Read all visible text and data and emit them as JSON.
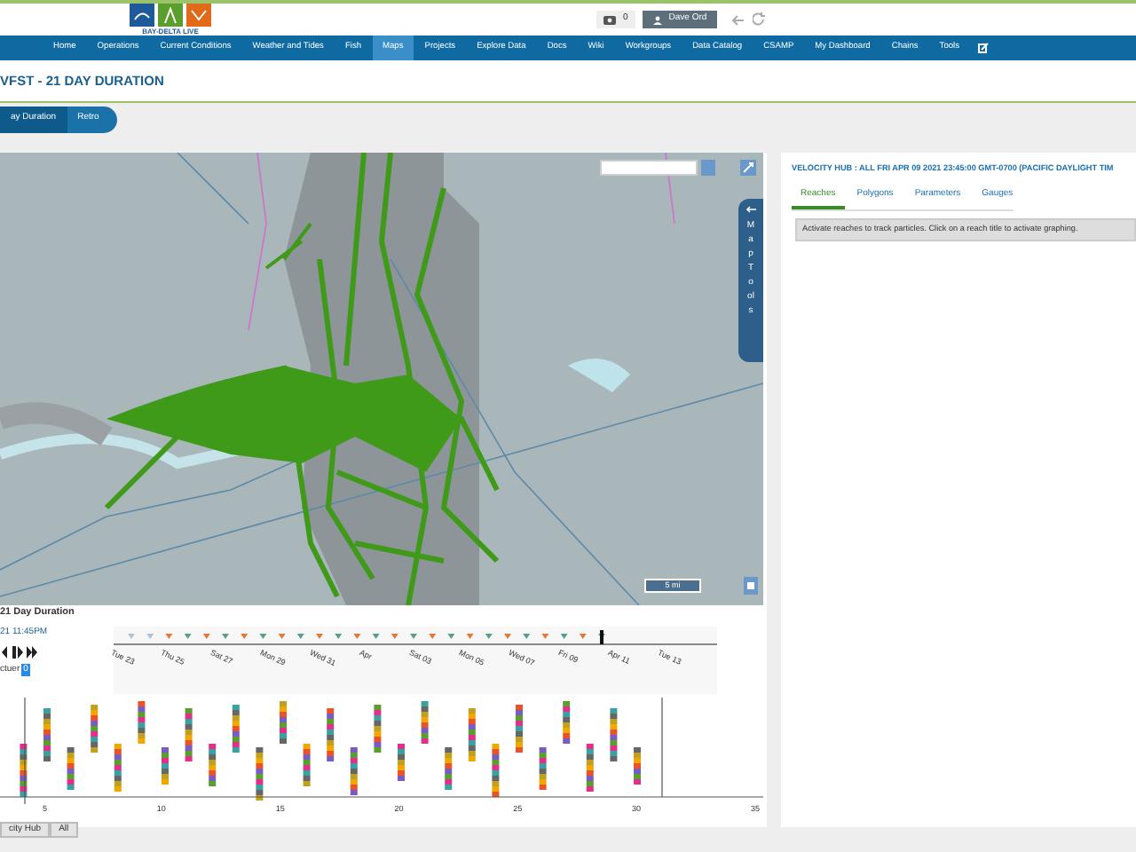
{
  "header": {
    "logo_text": "BAY-DELTA LIVE",
    "notifications": {
      "count": "0"
    },
    "user": {
      "name": "Dave Ord"
    }
  },
  "nav": [
    {
      "label": "Home",
      "selected": false
    },
    {
      "label": "Operations",
      "selected": false
    },
    {
      "label": "Current Conditions",
      "selected": false
    },
    {
      "label": "Weather and Tides",
      "selected": false
    },
    {
      "label": "Fish",
      "selected": false
    },
    {
      "label": "Maps",
      "selected": true
    },
    {
      "label": "Projects",
      "selected": false
    },
    {
      "label": "Explore Data",
      "selected": false
    },
    {
      "label": "Docs",
      "selected": false
    },
    {
      "label": "Wiki",
      "selected": false
    },
    {
      "label": "Workgroups",
      "selected": false
    },
    {
      "label": "Data Catalog",
      "selected": false
    },
    {
      "label": "CSAMP",
      "selected": false
    },
    {
      "label": "My Dashboard",
      "selected": false
    },
    {
      "label": "Chains",
      "selected": false
    },
    {
      "label": "Tools",
      "selected": false
    }
  ],
  "page_title": "VFST - 21 DAY DURATION",
  "tabs": [
    {
      "label": "ay Duration",
      "selected": true
    },
    {
      "label": "Retro",
      "selected": false
    }
  ],
  "map": {
    "scale": "5 mi",
    "tools_label": "Map Tools"
  },
  "timeline": {
    "title": "21 Day Duration",
    "current_time": "21 11:45PM",
    "structure_label": "ctuer",
    "structure_value": "0",
    "dates": [
      "Tue 23",
      "Thu 25",
      "Sat 27",
      "Mon 29",
      "Wed 31",
      "Apr",
      "Sat 03",
      "Mon 05",
      "Wed 07",
      "Fri 09",
      "Apr 11",
      "Tue 13"
    ],
    "x_ticks": [
      "5",
      "10",
      "15",
      "20",
      "25",
      "30",
      "35"
    ]
  },
  "bottom_tabs": [
    {
      "label": "city Hub",
      "selected": false
    },
    {
      "label": "All",
      "selected": false
    }
  ],
  "side_panel": {
    "title": "VELOCITY HUB : ALL FRI APR 09 2021 23:45:00 GMT-0700 (PACIFIC DAYLIGHT TIM",
    "tabs": [
      {
        "label": "Reaches",
        "selected": true
      },
      {
        "label": "Polygons",
        "selected": false
      },
      {
        "label": "Parameters",
        "selected": false
      },
      {
        "label": "Gauges",
        "selected": false
      }
    ],
    "message": "Activate reaches to track particles. Click on a reach title to activate graphing."
  }
}
